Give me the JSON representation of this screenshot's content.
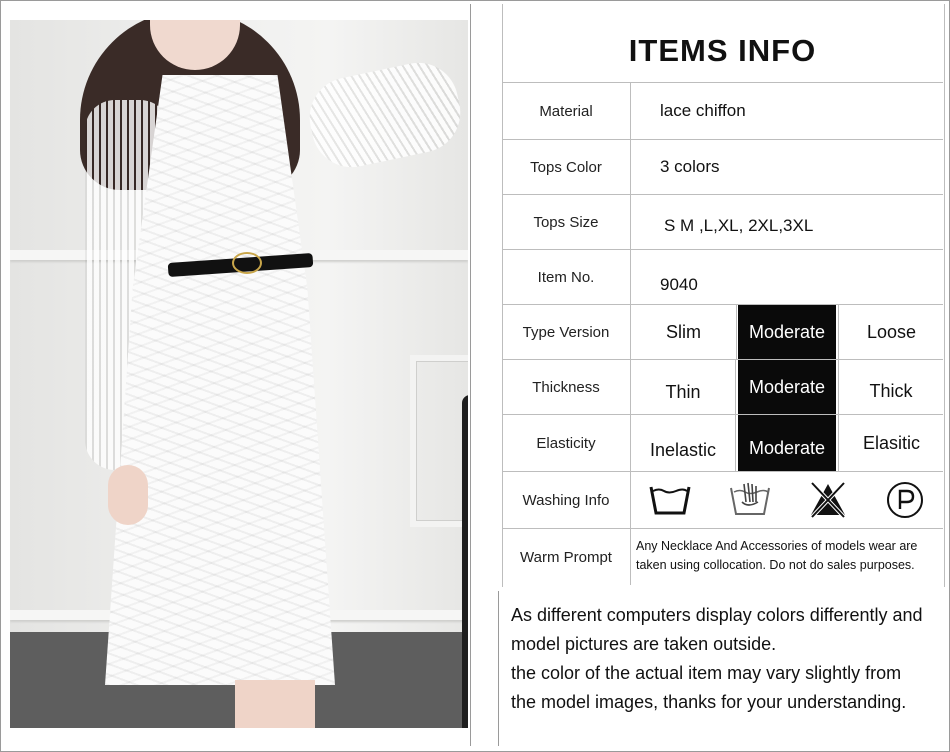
{
  "title": "ITEMS INFO",
  "rows": {
    "material": {
      "label": "Material",
      "value": "lace chiffon"
    },
    "tops_color": {
      "label": "Tops Color",
      "value": "3 colors"
    },
    "tops_size": {
      "label": "Tops Size",
      "value": "S M ,L,XL, 2XL,3XL"
    },
    "item_no": {
      "label": "Item No.",
      "value": "9040"
    },
    "type_version": {
      "label": "Type Version",
      "options": [
        "Slim",
        "Moderate",
        "Loose"
      ],
      "selected": "Moderate"
    },
    "thickness": {
      "label": "Thickness",
      "options": [
        "Thin",
        "Moderate",
        "Thick"
      ],
      "selected": "Moderate"
    },
    "elasticity": {
      "label": "Elasticity",
      "options": [
        "Inelastic",
        "Moderate",
        "Elasitic"
      ],
      "selected": "Moderate"
    },
    "washing_info": {
      "label": "Washing Info",
      "icons": [
        "wash-tub-icon",
        "hand-wash-icon",
        "no-bleach-icon",
        "dry-clean-p-icon"
      ]
    },
    "warm_prompt": {
      "label": "Warm Prompt",
      "text": "Any Necklace And Accessories of models wear are taken using collocation. Do not do sales purposes."
    }
  },
  "note": {
    "line1": "As different computers display colors differently and",
    "line2": "model pictures are taken outside.",
    "line3": "the color of the actual item may vary slightly from",
    "line4": "the model images, thanks for your understanding."
  },
  "colors": {
    "selected_bg": "#0a0a0a",
    "selected_text": "#ffffff",
    "grid": "#bdbdbd"
  }
}
